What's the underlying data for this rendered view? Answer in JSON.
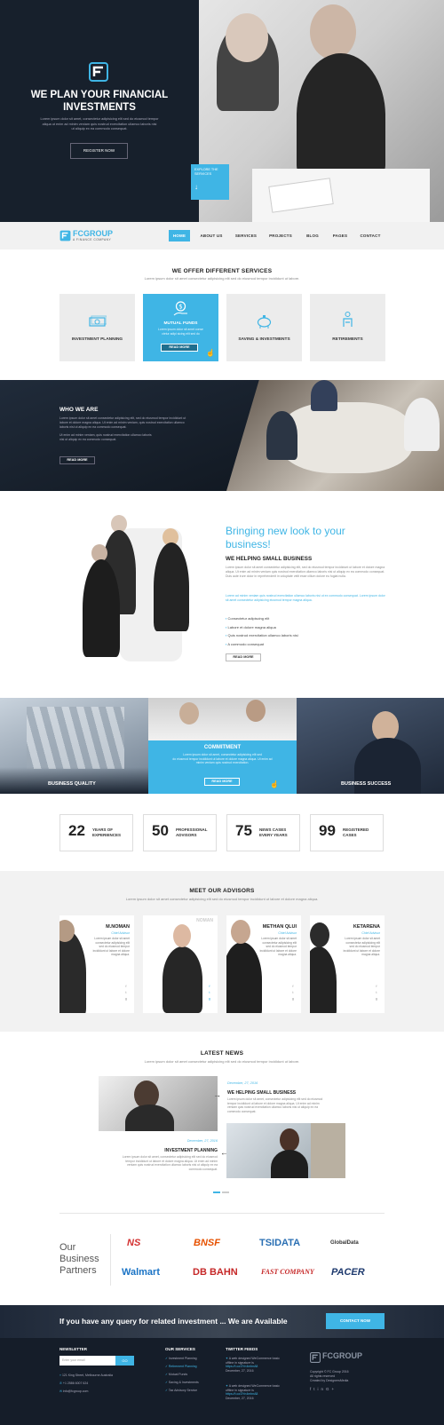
{
  "hero": {
    "title_line1": "WE PLAN YOUR FINANCIAL",
    "title_line2": "INVESTMENTS",
    "text_line1": "Lorem ipsum dolor sit amet, consectetur adipisicing elit sed do eiusmod tempor",
    "text_line2": "aliqua ut enim ad minim veniam quis nostrud exercitation ullamco laboris nisi",
    "text_line3": "ut aliquip ex ea commodo consequat.",
    "register_label": "REGISTER NOW",
    "explore_line1": "EXPLORE THE",
    "explore_line2": "SERVICES"
  },
  "nav": {
    "brand": "FCGROUP",
    "brand_sub": "A FINANCE COMPANY",
    "items": [
      "HOME",
      "ABOUT US",
      "SERVICES",
      "PROJECTS",
      "BLOG",
      "PAGES",
      "CONTACT"
    ]
  },
  "services": {
    "title": "WE OFFER DIFFERENT SERVICES",
    "subtitle": "Lorem ipsum dolor sit amet consectetur adipisicing elit sed do eiusmod tempor incididunt ut labore.",
    "cards": [
      {
        "label": "INVESTMENT PLANNING"
      },
      {
        "label": "MUTUAL FUNDS",
        "text1": "Lorem ipsum dolor sit amet conse",
        "text2": "ctetur adipi sicing elit sed do",
        "read_more": "READ MORE"
      },
      {
        "label": "SAVING & INVESTMENTS"
      },
      {
        "label": "RETIREMENTS"
      }
    ]
  },
  "who": {
    "title": "WHO WE ARE",
    "text1": "Lorem ipsum dolor sit amet consectetur adipisicing elit, sed do eiusmod tempor incididunt ut",
    "text2": "labore et dolore magna aliqua. Ut enim ad minim veniam, quis nostrud exercitation ullamco",
    "text3": "laboris nisi ut aliquip ex ea commodo consequat.",
    "text4": "Ut enim ad minim veniam, quis nostrud exercitation ullamco laboris",
    "text5": "nisi ut aliquip ex ea commodo consequat.",
    "read_more": "READ MORE"
  },
  "bringing": {
    "headline1": "Bringing new look to your",
    "headline2": "business!",
    "sub": "WE HELPING SMALL BUSINESS",
    "para1": "Lorem ipsum dolor sit amet consectetur adipisicing elit, sed do eiusmod tempor incididunt ut labore et dolore magna aliqua. Ut enim ad minim veniam quis nostrud exercitation ullamco laboris nisi ut aliquip ex ea commodo consequat. Duis aute irure dolor in reprehenderit in voluptate velit esse cillum dolore eu fugiat nulla.",
    "para2": "Lorem ad minim veniam quis nostrud exercitation ullamco laboris nisi ut ex commodo consequat. Lorem ipsum dolor sit amet consectetur adipisicing eiusmod tempor magna aliqua.",
    "bullets": [
      "Consectetur adipiscing elit",
      "Labore et dolore magna aliqua",
      "Quis nostrud exercitation ullamco laboris nisi",
      "A commodo consequat"
    ],
    "read_more": "READ MORE"
  },
  "features": {
    "left_label": "BUSINESS QUALITY",
    "mid_title": "COMMITMENT",
    "mid_text1": "Lorem ipsum dolor sit amet, consectetur adipisicing elit sed",
    "mid_text2": "do eiusmod tempor incididunt ut labore et dolore magna aliqua. Ut enim ad",
    "mid_text3": "minim veniam quis nostrud exercitation.",
    "read_more": "READ MORE",
    "right_label": "BUSINESS SUCCESS"
  },
  "stats": [
    {
      "num": "22",
      "l1": "YEARS OF",
      "l2": "EXPERIENCES"
    },
    {
      "num": "50",
      "l1": "PROFESSIONAL",
      "l2": "ADVISORS"
    },
    {
      "num": "75",
      "l1": "NEWS CASES",
      "l2": "EVERY YEARS"
    },
    {
      "num": "99",
      "l1": "REGISTERED",
      "l2": "CASES"
    }
  ],
  "advisors": {
    "title": "MEET OUR ADVISORS",
    "subtitle": "Lorem ipsum dolor sit amet consectetur adipisicing elit sed do eiusmod tempor incididunt ut labore et dolore magna aliqua.",
    "people": [
      {
        "name": "M.NOMAN",
        "role": "Chief Advisor",
        "text": "Lorem ipsum dolor sit amet consectetur adipisicing elit sed do eiusmod tempor incididunt ut labore et dolore magna aliqua."
      },
      {
        "name": "NOMAN",
        "role": "Chief Advisor",
        "text": "Lorem ipsum dolor sit amet consectetur adipisicing elit sed do eiusmod."
      },
      {
        "name": "METHAN QLUI",
        "role": "Chief Advisor",
        "text": "Lorem ipsum dolor sit amet consectetur adipisicing elit sed do eiusmod tempor incididunt ut labore et dolore magna aliqua."
      },
      {
        "name": "KETARENA",
        "role": "Chief Advisor",
        "text": "Lorem ipsum dolor sit amet consectetur adipisicing elit sed do eiusmod tempor incididunt ut labore et dolore magna aliqua."
      }
    ]
  },
  "news": {
    "title": "LATEST NEWS",
    "subtitle": "Lorem ipsum dolor sit amet consectetur adipisicing elit sed do eiusmod tempor incididunt ut labore.",
    "item1_date": "December, 27, 2016",
    "item1_title": "WE HELPING SMALL BUSINESS",
    "item1_text1": "Lorem ipsum dolor sit amet, consectetur adipisicing elit sed do eiusmod",
    "item1_text2": "tempor incididunt ut labore et dolore magna aliqua. Ut enim ad minim",
    "item1_text3": "veniam quis nostrud exercitation ullamco laboris nisi ut aliquip ex ea",
    "item1_text4": "commodo consequat.",
    "item2_date": "December, 27, 2016",
    "item2_title": "INVESTMENT PLANNING",
    "item2_text1": "Lorem ipsum dolor sit amet, consectetur adipisicing elit sed do eiusmod",
    "item2_text2": "tempor incididunt ut labore et dolore magna aliqua. Ut enim ad minim",
    "item2_text3": "veniam quis nostrud exercitation ullamco laboris nisi ut aliquip ex ea",
    "item2_text4": "commodo consequat."
  },
  "partners": {
    "heading1": "Our",
    "heading2": "Business",
    "heading3": "Partners",
    "logos": [
      "NS",
      "BNSF",
      "TSIDATA",
      "GlobalData",
      "Walmart",
      "DB BAHN",
      "FAST COMPANY",
      "PACER"
    ]
  },
  "cta": {
    "text": "If you have any query for related investment ... We are Available",
    "button": "CONTACT NOW"
  },
  "footer": {
    "newsletter": "NEWSLETTER",
    "email_placeholder": "Enter your email",
    "go": "GO",
    "address": "121 King Street, Melbourne Australia",
    "phone": "+1 2586 6007 624",
    "email": "info@fcgroup.com",
    "services_title": "OUR SERVICES",
    "services": [
      "Investment Planning",
      "Retirement Planning",
      "Mutual Funds",
      "Saving & Investments",
      "Tax Advisory Service"
    ],
    "twitter_title": "TWITTER FEEDS",
    "tweet1": "A web designed WeCommerce basic offline in signature is",
    "tweet1_link": "https://t.co/3Yn4mbnA8",
    "tweet1_date": "December, 27, 2016",
    "tweet2": "A web designed WeCommerce basic offline in signature is",
    "tweet2_link": "https://t.co/3Yn4mbnA8",
    "tweet2_date": "December, 27, 2016",
    "brand": "FCGROUP",
    "copyright": "Copyright © FC Group 2016",
    "rights": "All rights reserved",
    "created": "Created by DesignersMedia"
  }
}
